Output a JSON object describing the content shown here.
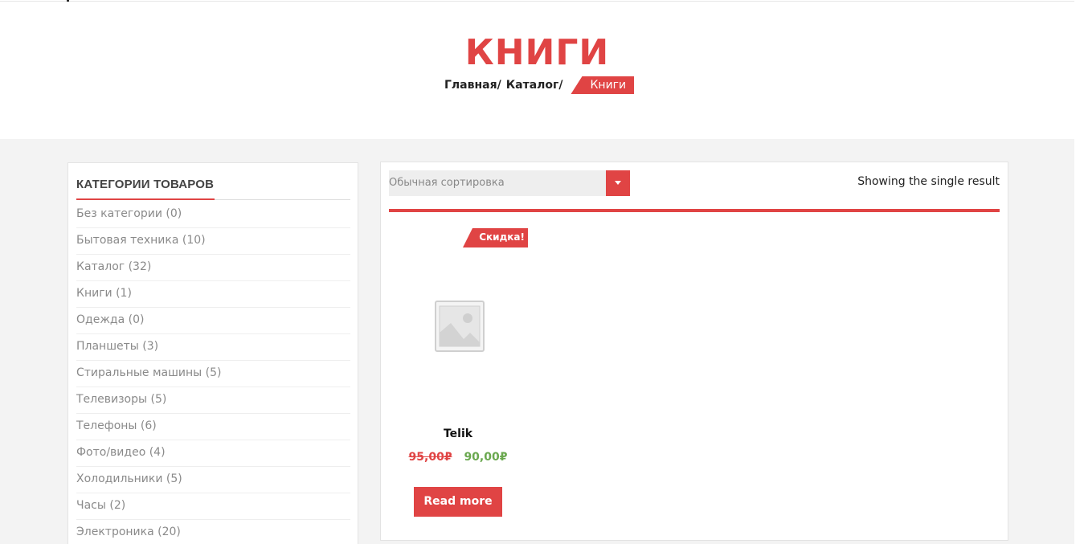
{
  "header": {
    "page_title": "КНИГИ",
    "breadcrumb": [
      {
        "label": "Главная"
      },
      {
        "label": "Каталог"
      }
    ],
    "breadcrumb_separator": "/",
    "breadcrumb_current": "Книги"
  },
  "sidebar": {
    "widget_title": "КАТЕГОРИИ ТОВАРОВ",
    "categories": [
      "Без категории (0)",
      "Бытовая техника (10)",
      "Каталог (32)",
      "Книги (1)",
      "Одежда (0)",
      "Планшеты (3)",
      "Стиральные машины (5)",
      "Телевизоры (5)",
      "Телефоны (6)",
      "Фото/видео (4)",
      "Холодильники (5)",
      "Часы (2)",
      "Электроника (20)"
    ]
  },
  "toolbar": {
    "sort_selected": "Обычная сортировка",
    "result_count": "Showing the single result"
  },
  "products": [
    {
      "badge": "Скидка!",
      "image_icon": "image-placeholder-icon",
      "name": "Telik",
      "old_price": "95,00₽",
      "new_price": "90,00₽",
      "button_label": "Read more"
    }
  ],
  "colors": {
    "accent": "#e04444",
    "price_new": "#6aa84f",
    "category_text": "#8a8a8a",
    "background": "#f3f3f3"
  }
}
